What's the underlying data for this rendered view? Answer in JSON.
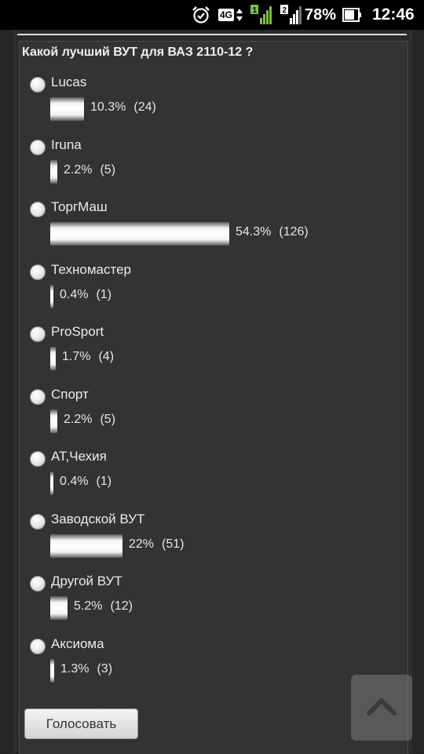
{
  "status_bar": {
    "network": "4G",
    "sim1": "1",
    "sim2": "2",
    "battery_percent": "78%",
    "time": "12:46"
  },
  "poll": {
    "title": "Какой лучший ВУТ для ВАЗ 2110-12 ?",
    "options": [
      {
        "label": "Lucas",
        "percent": "10.3%",
        "count": "(24)",
        "fraction": 0.103
      },
      {
        "label": "Iruna",
        "percent": "2.2%",
        "count": "(5)",
        "fraction": 0.022
      },
      {
        "label": "ТоргМаш",
        "percent": "54.3%",
        "count": "(126)",
        "fraction": 0.543
      },
      {
        "label": "Техномастер",
        "percent": "0.4%",
        "count": "(1)",
        "fraction": 0.004
      },
      {
        "label": "ProSport",
        "percent": "1.7%",
        "count": "(4)",
        "fraction": 0.017
      },
      {
        "label": "Спорт",
        "percent": "2.2%",
        "count": "(5)",
        "fraction": 0.022
      },
      {
        "label": "АТ,Чехия",
        "percent": "0.4%",
        "count": "(1)",
        "fraction": 0.004
      },
      {
        "label": "Заводской ВУТ",
        "percent": "22%",
        "count": "(51)",
        "fraction": 0.22
      },
      {
        "label": "Другой ВУТ",
        "percent": "5.2%",
        "count": "(12)",
        "fraction": 0.052
      },
      {
        "label": "Аксиома",
        "percent": "1.3%",
        "count": "(3)",
        "fraction": 0.013
      }
    ],
    "vote_label": "Голосовать"
  },
  "scroll_top_icon": "chevron-up-icon",
  "colors": {
    "background": "#262626",
    "panel": "#333333",
    "bar": "#f2f2f2"
  }
}
